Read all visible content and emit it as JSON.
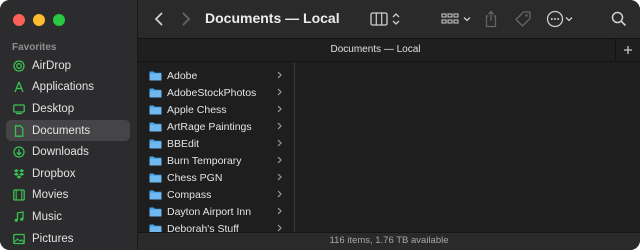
{
  "window": {
    "title": "Documents — Local",
    "tab_title": "Documents — Local",
    "status": "116 items, 1.76 TB available"
  },
  "sidebar": {
    "heading": "Favorites",
    "items": [
      {
        "label": "AirDrop",
        "icon": "airdrop-icon"
      },
      {
        "label": "Applications",
        "icon": "applications-icon"
      },
      {
        "label": "Desktop",
        "icon": "desktop-icon"
      },
      {
        "label": "Documents",
        "icon": "document-icon",
        "active": true
      },
      {
        "label": "Downloads",
        "icon": "download-icon"
      },
      {
        "label": "Dropbox",
        "icon": "dropbox-icon"
      },
      {
        "label": "Movies",
        "icon": "movies-icon"
      },
      {
        "label": "Music",
        "icon": "music-icon"
      },
      {
        "label": "Pictures",
        "icon": "pictures-icon"
      }
    ]
  },
  "files": [
    {
      "name": "Adobe"
    },
    {
      "name": "AdobeStockPhotos"
    },
    {
      "name": "Apple Chess"
    },
    {
      "name": "ArtRage Paintings"
    },
    {
      "name": "BBEdit"
    },
    {
      "name": "Burn Temporary"
    },
    {
      "name": "Chess PGN"
    },
    {
      "name": "Compass"
    },
    {
      "name": "Dayton Airport Inn"
    },
    {
      "name": "Deborah's Stuff"
    }
  ],
  "colors": {
    "sidebar_accent": "#39c152",
    "folder": "#4aa3e8",
    "active_item_bg": "#454447"
  }
}
